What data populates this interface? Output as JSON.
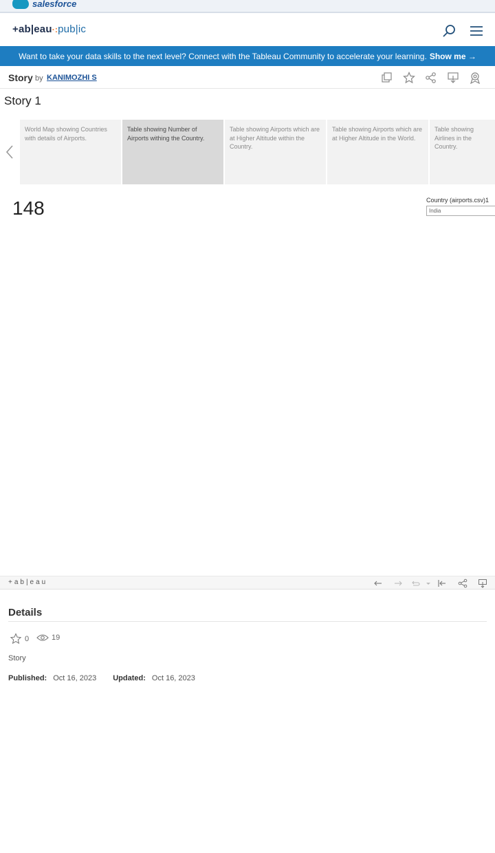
{
  "salesforce": {
    "brand": "salesforce"
  },
  "header": {
    "logo": {
      "prefix": "+ab|eau",
      "dots": "·:",
      "suffix": "pub|ic"
    },
    "search_icon": "search-icon",
    "menu_icon": "hamburger-menu-icon"
  },
  "banner": {
    "text": "Want to take your data skills to the next level? Connect with the Tableau Community to accelerate your learning.",
    "cta": "Show me →"
  },
  "story_bar": {
    "kind": "Story",
    "by": "by",
    "author": "KANIMOZHI S",
    "tools": [
      "copy-icon",
      "favorite-star-icon",
      "share-icon",
      "download-icon",
      "badge-icon"
    ]
  },
  "story": {
    "title": "Story 1",
    "points": [
      {
        "caption": "World Map showing Countries with details of Airports."
      },
      {
        "caption": "Table showing Number of Airports withing the Country."
      },
      {
        "caption": "Table showing Airports which are at Higher Altitude within the Country."
      },
      {
        "caption": "Table showing Airports which are at Higher Altitude in the World."
      },
      {
        "caption": "Table showing Airlines in the Country."
      }
    ],
    "active_index": 1
  },
  "viz": {
    "value": "148",
    "filter_label": "Country (airports.csv)1",
    "filter_value": "India"
  },
  "footer": {
    "logo": "+ab|eau"
  },
  "details": {
    "title": "Details",
    "favorites": "0",
    "views": "19",
    "type": "Story",
    "published_label": "Published:",
    "published": "Oct 16, 2023",
    "updated_label": "Updated:",
    "updated": "Oct 16, 2023"
  },
  "colors": {
    "banner": "#1e7dc1",
    "brand_blue": "#1b5297",
    "accent_orange": "#e8762d"
  }
}
